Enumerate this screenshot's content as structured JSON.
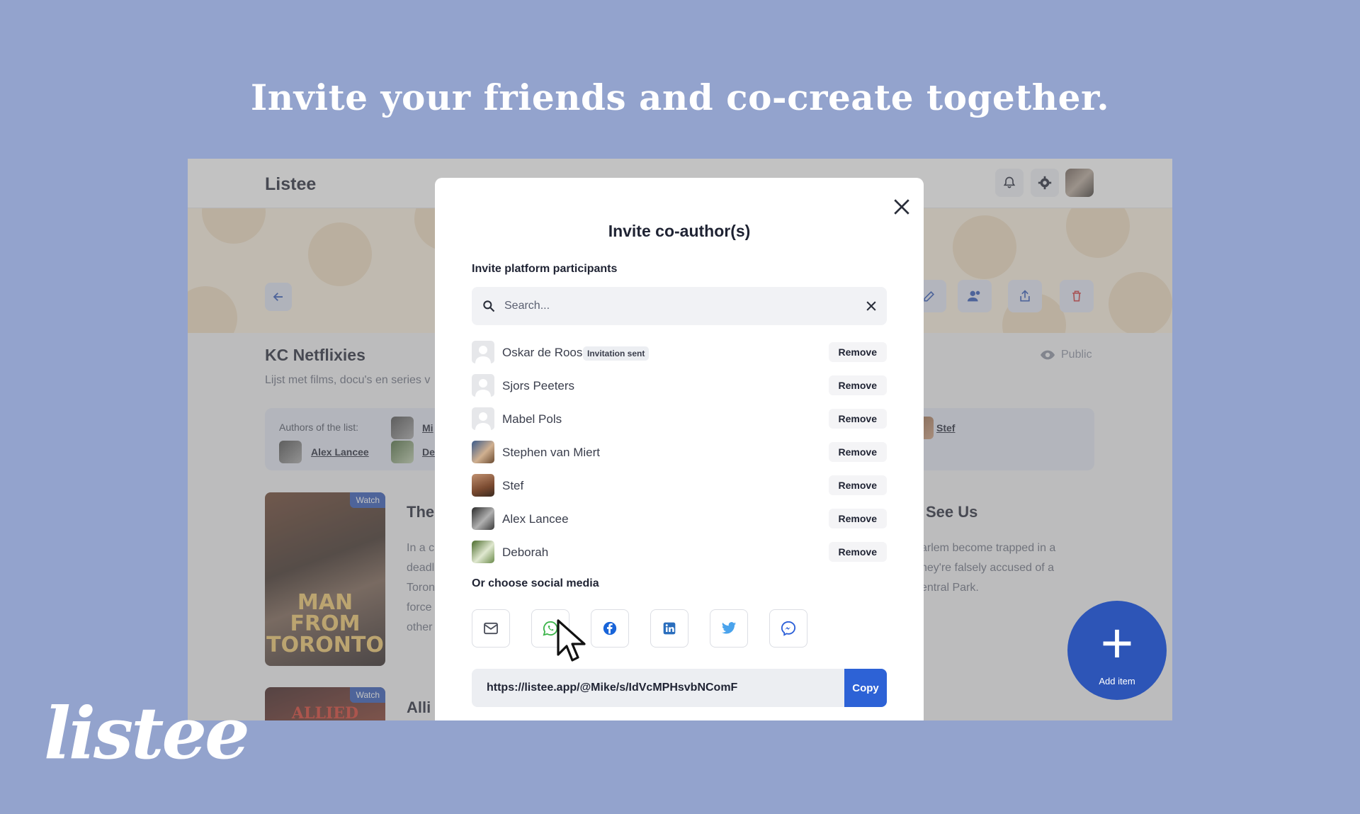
{
  "headline": "Invite your friends and co-create together.",
  "app": {
    "brand": "Listee",
    "list_title": "KC Netflixies",
    "list_description": "Lijst met films, docu's en series v",
    "visibility": "Public",
    "authors_label": "Authors of the list:",
    "authors": [
      "Alex Lancee",
      "Mi",
      "De",
      "Stef"
    ],
    "items": [
      {
        "watch": "Watch",
        "poster_text": "MAN FROM TORONTO",
        "title": "The",
        "desc_left": [
          "In a c",
          "deadl",
          "Toron",
          "force",
          "other"
        ]
      },
      {
        "watch": "Watch",
        "poster_text": "ALLIED",
        "title": "Alli"
      }
    ],
    "right_item": {
      "title": "See Us",
      "desc": [
        "arlem become trapped in a",
        "hey're falsely accused of a",
        "entral Park."
      ]
    },
    "fab_label": "Add item",
    "colors": {
      "accent": "#2d55b7",
      "copy_button": "#2d62d6",
      "background": "#93a3cd"
    }
  },
  "modal": {
    "title": "Invite co-author(s)",
    "participants_label": "Invite platform participants",
    "search_placeholder": "Search...",
    "participants": [
      {
        "name": "Oskar de Roos",
        "badge": "Invitation sent",
        "action": "Remove"
      },
      {
        "name": "Sjors Peeters",
        "action": "Remove"
      },
      {
        "name": "Mabel Pols",
        "action": "Remove"
      },
      {
        "name": "Stephen van Miert",
        "action": "Remove"
      },
      {
        "name": "Stef",
        "action": "Remove"
      },
      {
        "name": "Alex Lancee",
        "action": "Remove"
      },
      {
        "name": "Deborah",
        "action": "Remove"
      }
    ],
    "social_label": "Or choose social media",
    "social": [
      "mail-icon",
      "whatsapp-icon",
      "facebook-icon",
      "linkedin-icon",
      "twitter-icon",
      "messenger-icon"
    ],
    "link": "https://listee.app/@Mike/s/IdVcMPHsvbNComF",
    "copy_label": "Copy"
  },
  "logo": "listee"
}
